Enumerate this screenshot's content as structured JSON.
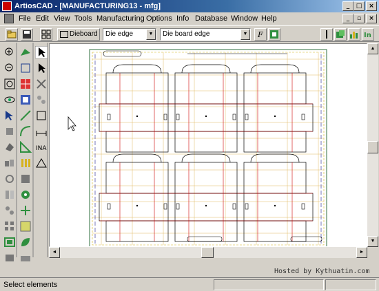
{
  "title": "ArtiosCAD - [MANUFACTURING13 - mfg]",
  "menu": [
    "File",
    "Edit",
    "View",
    "Tools",
    "Manufacturing",
    "Options",
    "Info",
    "Database",
    "Window",
    "Help"
  ],
  "toolbar": {
    "dieboard_label": "Dieboard",
    "select1_value": "Die edge",
    "select2_value": "Die board edge"
  },
  "status": "Select elements",
  "watermark": "Hosted by Kythuatin.com",
  "icons": {
    "caption": [
      "minimize-icon",
      "maximize-icon",
      "close-icon"
    ],
    "toolbar_left": [
      "open-folder-icon",
      "save-icon",
      "layout-icon"
    ],
    "toolbar_right": [
      "pointer-icon",
      "layer-icon",
      "chart-icon",
      "info-icon"
    ]
  }
}
